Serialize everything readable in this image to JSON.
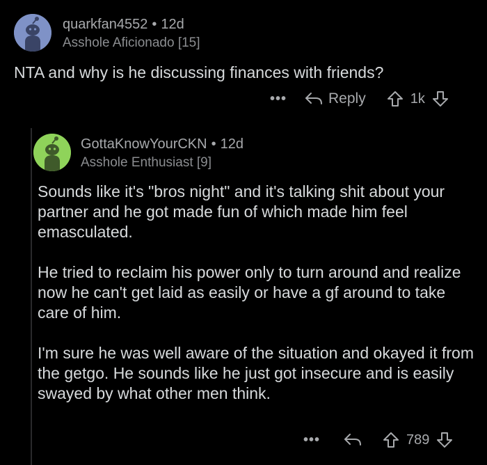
{
  "comment1": {
    "username": "quarkfan4552",
    "separator": "•",
    "age": "12d",
    "flair": "Asshole Aficionado [15]",
    "avatar_color": "#7f92c7",
    "body": "NTA and why is he discussing finances with friends?",
    "actions": {
      "more": "•••",
      "reply_label": "Reply",
      "score": "1k"
    }
  },
  "comment2": {
    "username": "GottaKnowYourCKN",
    "separator": "•",
    "age": "12d",
    "flair": "Asshole Enthusiast [9]",
    "avatar_color": "#8fd35a",
    "paragraphs": [
      "Sounds like it's \"bros night\" and it's talking shit about your partner and he got made fun of which made him feel emasculated.",
      "He tried to reclaim his power only to turn around and realize now he can't get laid as easily or have a gf around to take care of him.",
      "I'm sure he was well aware of the situation and okayed it from the getgo. He sounds like he just got insecure and is easily swayed by what other men think."
    ],
    "actions": {
      "more": "•••",
      "score": "789"
    }
  },
  "icons": [
    "snoo-avatar-icon",
    "reply-arrow-icon",
    "upvote-icon",
    "downvote-icon",
    "more-dots-icon"
  ],
  "colors": {
    "background": "#000000",
    "text": "#d7dadc",
    "meta": "#a8aaad"
  }
}
